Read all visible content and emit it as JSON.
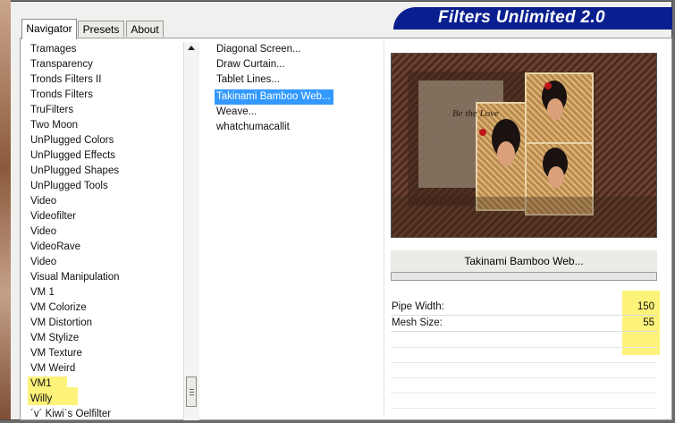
{
  "app": {
    "title": "Filters Unlimited 2.0"
  },
  "tabs": [
    {
      "label": "Navigator"
    },
    {
      "label": "Presets"
    },
    {
      "label": "About"
    }
  ],
  "categories": [
    "Tramages",
    "Transparency",
    "Tronds Filters II",
    "Tronds Filters",
    "TruFilters",
    "Two Moon",
    "UnPlugged Colors",
    "UnPlugged Effects",
    "UnPlugged Shapes",
    "UnPlugged Tools",
    "Video",
    "Videofilter",
    "Video",
    "VideoRave",
    "Video",
    "Visual Manipulation",
    "VM 1",
    "VM Colorize",
    "VM Distortion",
    "VM Stylize",
    "VM Texture",
    "VM Weird",
    "VM1",
    "Willy",
    "´v´ Kiwi`s Oelfilter"
  ],
  "filters": [
    "Diagonal Screen...",
    "Draw Curtain...",
    "Tablet Lines...",
    "Takinami Bamboo Web...",
    "Weave...",
    "whatchumacallit"
  ],
  "selected_filter": "Takinami Bamboo Web...",
  "params": [
    {
      "label": "Pipe Width:",
      "value": "150"
    },
    {
      "label": "Mesh Size:",
      "value": "55"
    }
  ],
  "preview": {
    "text": "Be the Love"
  },
  "colors": {
    "banner": "#0a1f8f",
    "selection": "#3399ff",
    "highlight": "#fdf27a"
  }
}
